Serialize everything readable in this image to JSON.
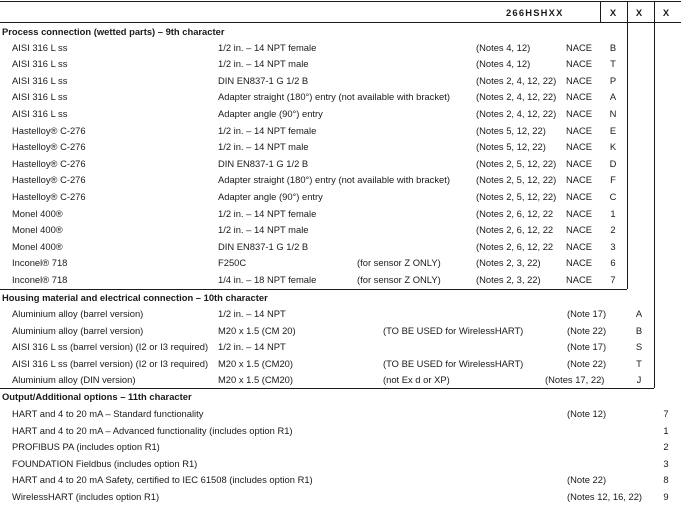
{
  "header": {
    "model": "266HSHXX",
    "cols": [
      "X",
      "X",
      "X"
    ]
  },
  "sections": [
    {
      "title": "Process connection (wetted parts) – 9th character",
      "rows": [
        {
          "material": "AISI 316 L ss",
          "connection": "1/2 in. – 14 NPT female",
          "extra": "",
          "notes": "(Notes 4, 12)",
          "nace": "NACE",
          "code": "B"
        },
        {
          "material": "AISI 316 L ss",
          "connection": "1/2 in. – 14 NPT male",
          "extra": "",
          "notes": "(Notes 4, 12)",
          "nace": "NACE",
          "code": "T"
        },
        {
          "material": "AISI 316 L ss",
          "connection": "DIN EN837-1 G 1/2 B",
          "extra": "",
          "notes": "(Notes 2, 4, 12, 22)",
          "nace": "NACE",
          "code": "P"
        },
        {
          "material": "AISI 316 L ss",
          "connection": "Adapter straight (180°) entry (not available with bracket)",
          "extra": "",
          "notes": "(Notes 2, 4, 12, 22)",
          "nace": "NACE",
          "code": "A"
        },
        {
          "material": "AISI 316 L ss",
          "connection": "Adapter angle (90°) entry",
          "extra": "",
          "notes": "(Notes 2, 4, 12, 22)",
          "nace": "NACE",
          "code": "N"
        },
        {
          "material": "Hastelloy® C-276",
          "connection": "1/2 in. – 14 NPT female",
          "extra": "",
          "notes": "(Notes 5, 12, 22)",
          "nace": "NACE",
          "code": "E"
        },
        {
          "material": "Hastelloy® C-276",
          "connection": "1/2 in. – 14 NPT male",
          "extra": "",
          "notes": "(Notes 5, 12, 22)",
          "nace": "NACE",
          "code": "K"
        },
        {
          "material": "Hastelloy® C-276",
          "connection": "DIN EN837-1 G 1/2 B",
          "extra": "",
          "notes": "(Notes 2, 5, 12, 22)",
          "nace": "NACE",
          "code": "D"
        },
        {
          "material": "Hastelloy® C-276",
          "connection": "Adapter straight (180°) entry (not available with bracket)",
          "extra": "",
          "notes": "(Notes 2, 5, 12, 22)",
          "nace": "NACE",
          "code": "F"
        },
        {
          "material": "Hastelloy® C-276",
          "connection": "Adapter angle (90°) entry",
          "extra": "",
          "notes": "(Notes 2, 5, 12, 22)",
          "nace": "NACE",
          "code": "C"
        },
        {
          "material": "Monel 400®",
          "connection": "1/2 in. – 14 NPT female",
          "extra": "",
          "notes": "(Notes 2, 6, 12, 22",
          "nace": "NACE",
          "code": "1"
        },
        {
          "material": "Monel 400®",
          "connection": "1/2 in. – 14 NPT male",
          "extra": "",
          "notes": "(Notes 2, 6, 12, 22",
          "nace": "NACE",
          "code": "2"
        },
        {
          "material": "Monel 400®",
          "connection": "DIN EN837-1 G 1/2 B",
          "extra": "",
          "notes": "(Notes 2, 6, 12, 22",
          "nace": "NACE",
          "code": "3"
        },
        {
          "material": "Inconel® 718",
          "connection": "F250C",
          "extra": "(for sensor Z ONLY)",
          "notes": "(Notes 2, 3, 22)",
          "nace": "NACE",
          "code": "6"
        },
        {
          "material": "Inconel® 718",
          "connection": "1/4 in. – 18 NPT female",
          "extra": "(for sensor Z ONLY)",
          "notes": "(Notes 2, 3, 22)",
          "nace": "NACE",
          "code": "7"
        }
      ]
    },
    {
      "title": "Housing material and electrical connection – 10th character",
      "rows": [
        {
          "material": "Aluminium alloy (barrel version)",
          "connection": "1/2 in. – 14 NPT",
          "extra": "",
          "notes": "(Note 17)",
          "code": "A"
        },
        {
          "material": "Aluminium alloy (barrel version)",
          "connection": "M20 x 1.5 (CM 20)",
          "extra": "(TO BE USED for WirelessHART)",
          "notes": "(Note 22)",
          "code": "B"
        },
        {
          "material": "AISI 316 L ss (barrel version) (I2 or I3 required)",
          "connection": "1/2 in. – 14 NPT",
          "extra": "",
          "notes": "(Note 17)",
          "code": "S"
        },
        {
          "material": "AISI 316 L ss (barrel version) (I2 or I3 required)",
          "connection": "M20 x 1.5 (CM20)",
          "extra": "(TO BE USED for WirelessHART)",
          "notes": "(Note 22)",
          "code": "T"
        },
        {
          "material": "Aluminium alloy (DIN version)",
          "connection": "M20 x 1.5 (CM20)",
          "extra": "(not Ex d or XP)",
          "notes": "(Notes 17, 22)",
          "code": "J"
        }
      ]
    },
    {
      "title": "Output/Additional options – 11th character",
      "rows": [
        {
          "label": "HART and 4 to 20 mA – Standard functionality",
          "notes": "(Note 12)",
          "code": "7"
        },
        {
          "label": "HART and 4 to 20 mA – Advanced functionality (includes option R1)",
          "notes": "",
          "code": "1"
        },
        {
          "label": "PROFIBUS PA (includes option R1)",
          "notes": "",
          "code": "2"
        },
        {
          "label": "FOUNDATION Fieldbus (includes option R1)",
          "notes": "",
          "code": "3"
        },
        {
          "label": "HART and 4 to 20 mA Safety, certified to IEC 61508 (includes option R1)",
          "notes": "(Note 22)",
          "code": "8"
        },
        {
          "label": "WirelessHART (includes option R1)",
          "notes": "(Notes 12, 16, 22)",
          "code": "9"
        }
      ]
    }
  ]
}
